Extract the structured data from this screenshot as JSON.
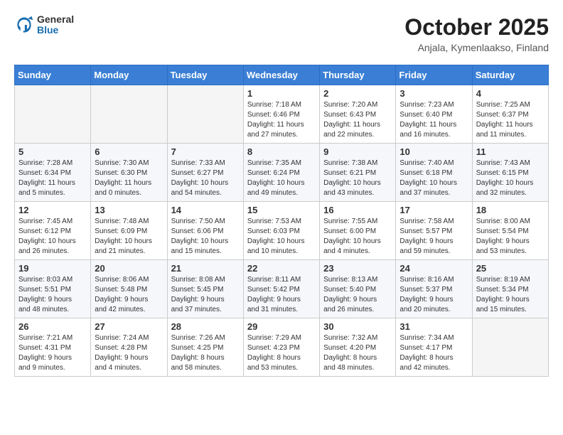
{
  "header": {
    "logo_general": "General",
    "logo_blue": "Blue",
    "month_title": "October 2025",
    "location": "Anjala, Kymenlaakso, Finland"
  },
  "days_of_week": [
    "Sunday",
    "Monday",
    "Tuesday",
    "Wednesday",
    "Thursday",
    "Friday",
    "Saturday"
  ],
  "weeks": [
    [
      {
        "day": "",
        "info": ""
      },
      {
        "day": "",
        "info": ""
      },
      {
        "day": "",
        "info": ""
      },
      {
        "day": "1",
        "info": "Sunrise: 7:18 AM\nSunset: 6:46 PM\nDaylight: 11 hours\nand 27 minutes."
      },
      {
        "day": "2",
        "info": "Sunrise: 7:20 AM\nSunset: 6:43 PM\nDaylight: 11 hours\nand 22 minutes."
      },
      {
        "day": "3",
        "info": "Sunrise: 7:23 AM\nSunset: 6:40 PM\nDaylight: 11 hours\nand 16 minutes."
      },
      {
        "day": "4",
        "info": "Sunrise: 7:25 AM\nSunset: 6:37 PM\nDaylight: 11 hours\nand 11 minutes."
      }
    ],
    [
      {
        "day": "5",
        "info": "Sunrise: 7:28 AM\nSunset: 6:34 PM\nDaylight: 11 hours\nand 5 minutes."
      },
      {
        "day": "6",
        "info": "Sunrise: 7:30 AM\nSunset: 6:30 PM\nDaylight: 11 hours\nand 0 minutes."
      },
      {
        "day": "7",
        "info": "Sunrise: 7:33 AM\nSunset: 6:27 PM\nDaylight: 10 hours\nand 54 minutes."
      },
      {
        "day": "8",
        "info": "Sunrise: 7:35 AM\nSunset: 6:24 PM\nDaylight: 10 hours\nand 49 minutes."
      },
      {
        "day": "9",
        "info": "Sunrise: 7:38 AM\nSunset: 6:21 PM\nDaylight: 10 hours\nand 43 minutes."
      },
      {
        "day": "10",
        "info": "Sunrise: 7:40 AM\nSunset: 6:18 PM\nDaylight: 10 hours\nand 37 minutes."
      },
      {
        "day": "11",
        "info": "Sunrise: 7:43 AM\nSunset: 6:15 PM\nDaylight: 10 hours\nand 32 minutes."
      }
    ],
    [
      {
        "day": "12",
        "info": "Sunrise: 7:45 AM\nSunset: 6:12 PM\nDaylight: 10 hours\nand 26 minutes."
      },
      {
        "day": "13",
        "info": "Sunrise: 7:48 AM\nSunset: 6:09 PM\nDaylight: 10 hours\nand 21 minutes."
      },
      {
        "day": "14",
        "info": "Sunrise: 7:50 AM\nSunset: 6:06 PM\nDaylight: 10 hours\nand 15 minutes."
      },
      {
        "day": "15",
        "info": "Sunrise: 7:53 AM\nSunset: 6:03 PM\nDaylight: 10 hours\nand 10 minutes."
      },
      {
        "day": "16",
        "info": "Sunrise: 7:55 AM\nSunset: 6:00 PM\nDaylight: 10 hours\nand 4 minutes."
      },
      {
        "day": "17",
        "info": "Sunrise: 7:58 AM\nSunset: 5:57 PM\nDaylight: 9 hours\nand 59 minutes."
      },
      {
        "day": "18",
        "info": "Sunrise: 8:00 AM\nSunset: 5:54 PM\nDaylight: 9 hours\nand 53 minutes."
      }
    ],
    [
      {
        "day": "19",
        "info": "Sunrise: 8:03 AM\nSunset: 5:51 PM\nDaylight: 9 hours\nand 48 minutes."
      },
      {
        "day": "20",
        "info": "Sunrise: 8:06 AM\nSunset: 5:48 PM\nDaylight: 9 hours\nand 42 minutes."
      },
      {
        "day": "21",
        "info": "Sunrise: 8:08 AM\nSunset: 5:45 PM\nDaylight: 9 hours\nand 37 minutes."
      },
      {
        "day": "22",
        "info": "Sunrise: 8:11 AM\nSunset: 5:42 PM\nDaylight: 9 hours\nand 31 minutes."
      },
      {
        "day": "23",
        "info": "Sunrise: 8:13 AM\nSunset: 5:40 PM\nDaylight: 9 hours\nand 26 minutes."
      },
      {
        "day": "24",
        "info": "Sunrise: 8:16 AM\nSunset: 5:37 PM\nDaylight: 9 hours\nand 20 minutes."
      },
      {
        "day": "25",
        "info": "Sunrise: 8:19 AM\nSunset: 5:34 PM\nDaylight: 9 hours\nand 15 minutes."
      }
    ],
    [
      {
        "day": "26",
        "info": "Sunrise: 7:21 AM\nSunset: 4:31 PM\nDaylight: 9 hours\nand 9 minutes."
      },
      {
        "day": "27",
        "info": "Sunrise: 7:24 AM\nSunset: 4:28 PM\nDaylight: 9 hours\nand 4 minutes."
      },
      {
        "day": "28",
        "info": "Sunrise: 7:26 AM\nSunset: 4:25 PM\nDaylight: 8 hours\nand 58 minutes."
      },
      {
        "day": "29",
        "info": "Sunrise: 7:29 AM\nSunset: 4:23 PM\nDaylight: 8 hours\nand 53 minutes."
      },
      {
        "day": "30",
        "info": "Sunrise: 7:32 AM\nSunset: 4:20 PM\nDaylight: 8 hours\nand 48 minutes."
      },
      {
        "day": "31",
        "info": "Sunrise: 7:34 AM\nSunset: 4:17 PM\nDaylight: 8 hours\nand 42 minutes."
      },
      {
        "day": "",
        "info": ""
      }
    ]
  ]
}
